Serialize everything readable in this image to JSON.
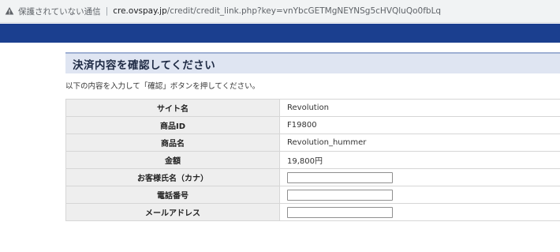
{
  "address_bar": {
    "insecure_label": "保護されていない通信",
    "separator": "|",
    "url_host": "cre.ovspay.jp",
    "url_path": "/credit/credit_link.php?key=vnYbcGETMgNEYNSg5cHVQluQo0fbLq"
  },
  "page": {
    "title": "決済内容を確認してください",
    "instruction": "以下の内容を入力して「確認」ボタンを押してください。"
  },
  "rows": [
    {
      "label": "サイト名",
      "value": "Revolution"
    },
    {
      "label": "商品ID",
      "value": "F19800"
    },
    {
      "label": "商品名",
      "value": "Revolution_hummer"
    },
    {
      "label": "金額",
      "value": "19,800円"
    },
    {
      "label": "お客様氏名（カナ）",
      "value": ""
    },
    {
      "label": "電話番号",
      "value": ""
    },
    {
      "label": "メールアドレス",
      "value": ""
    }
  ],
  "colors": {
    "header_band": "#1b3f8f",
    "title_background": "#dfe5f2",
    "label_cell_background": "#eeeeee"
  }
}
